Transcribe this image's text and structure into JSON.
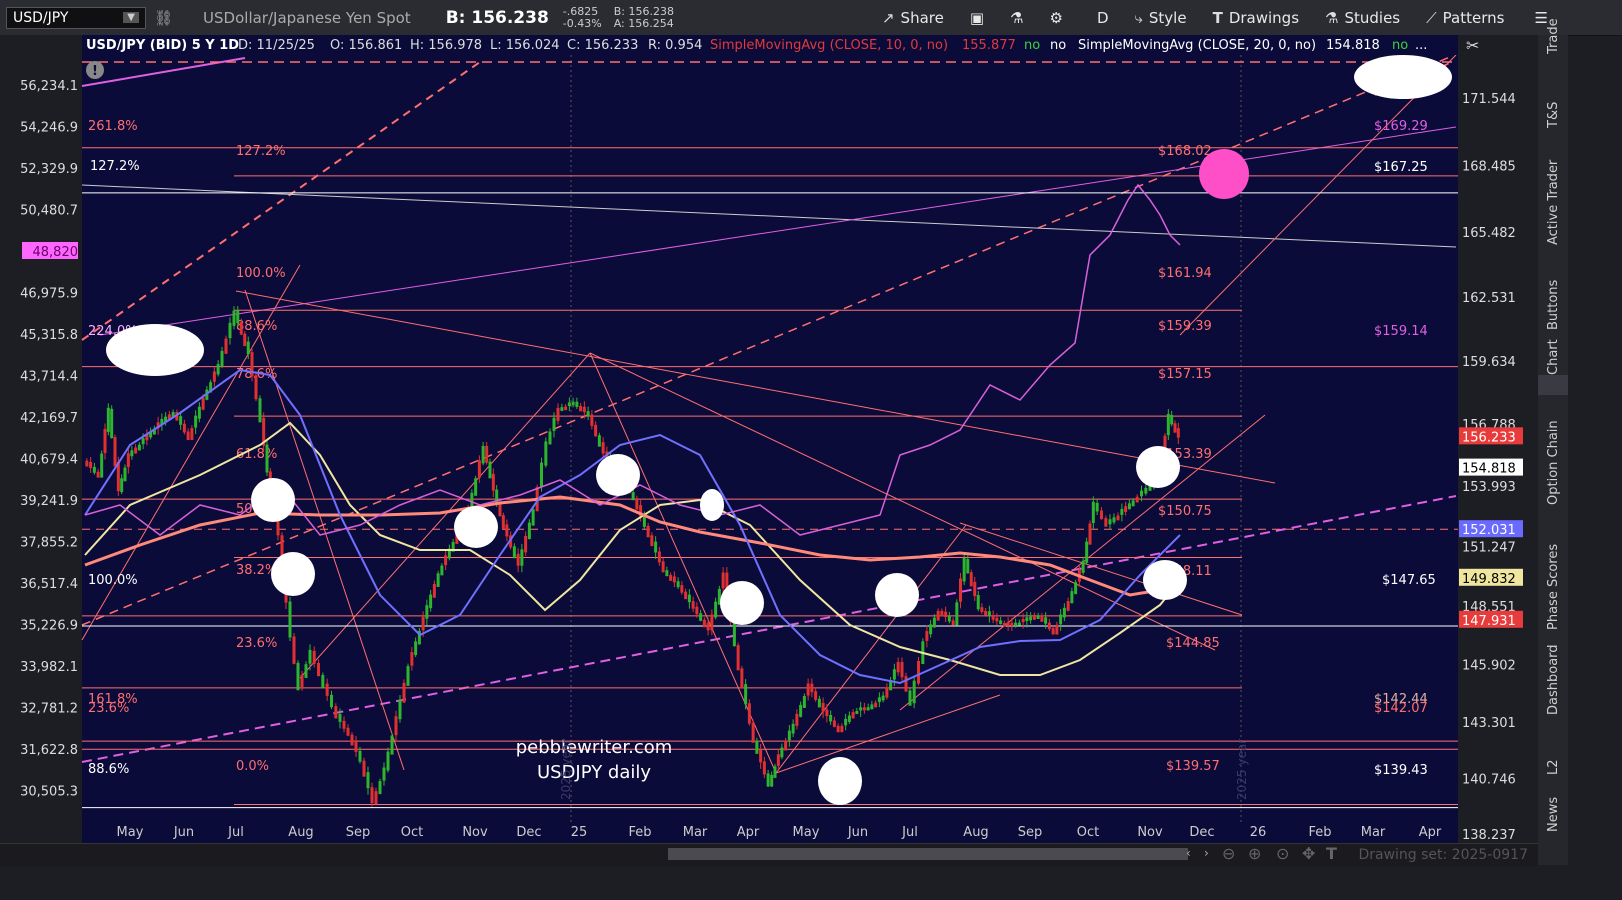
{
  "toolbar": {
    "symbol": "USD/JPY",
    "description": "USDollar/Japanese Yen Spot",
    "bid": "B: 156.238",
    "change": "-.6825",
    "change_pct": "-0.43%",
    "bid_small": "B: 156.238",
    "ask_small": "A: 156.254",
    "share_label": "Share",
    "period_label": "D",
    "style_label": "Style",
    "drawings_label": "Drawings",
    "studies_label": "Studies",
    "patterns_label": "Patterns"
  },
  "header": {
    "title": "USD/JPY (BID) 5 Y 1D",
    "date": "D: 11/25/25",
    "open": "O: 156.861",
    "high": "H: 156.978",
    "low": "L: 156.024",
    "close": "C: 156.233",
    "range": "R: 0.954",
    "sma10": "SimpleMovingAvg (CLOSE, 10, 0, no)",
    "sma10_val": "155.877",
    "no1": "no",
    "no2": "no",
    "sma20": "SimpleMovingAvg (CLOSE, 20, 0, no)",
    "sma20_val": "154.818",
    "no3": "no",
    "dots": "..."
  },
  "left_axis": [
    "56,234.1",
    "54,246.9",
    "52,329.9",
    "50,480.7",
    "48,820",
    "46,975.9",
    "45,315.8",
    "43,714.4",
    "42,169.7",
    "40,679.4",
    "39,241.9",
    "37,855.2",
    "36,517.4",
    "35,226.9",
    "33,982.1",
    "32,781.2",
    "31,622.8",
    "30,505.3"
  ],
  "right_axis": [
    "171.544",
    "168.485",
    "165.482",
    "162.531",
    "159.634",
    "156.788",
    "153.993",
    "151.247",
    "148.551",
    "145.902",
    "143.301",
    "140.746",
    "138.237"
  ],
  "price_tags": {
    "last": "156.233",
    "sma20": "154.818",
    "blue": "152.031",
    "yellow": "149.832",
    "red": "147.931"
  },
  "x_axis": [
    "May",
    "Jun",
    "Jul",
    "Aug",
    "Sep",
    "Oct",
    "Nov",
    "Dec",
    "25",
    "Feb",
    "Mar",
    "Apr",
    "May",
    "Jun",
    "Jul",
    "Aug",
    "Sep",
    "Oct",
    "Nov",
    "Dec",
    "26",
    "Feb",
    "Mar",
    "Apr"
  ],
  "fib_left": [
    "261.8%",
    "127.2%",
    "100.0%",
    "224.0%",
    "88.6%",
    "78.6%",
    "61.8%",
    "50.0%",
    "38.2%",
    "100.0%",
    "23.6%",
    "161.8%",
    "23.6%",
    "88.6%",
    "0.0%",
    "127.2%"
  ],
  "fib_right": [
    "$169.29",
    "$168.02",
    "$167.25",
    "$161.94",
    "$159.39",
    "$159.14",
    "$157.15",
    "$153.39",
    "$150.75",
    "$148.11",
    "$147.65",
    "$144.85",
    "$142.44",
    "$142.07",
    "$139.57",
    "$139.43"
  ],
  "watermark": {
    "line1": "pebblewriter.com",
    "line2": "USDJPY daily",
    "year1": "2025 year",
    "year2": "2025 year"
  },
  "side_tabs": [
    "Trade",
    "T&S",
    "Active Trader",
    "Buttons",
    "Chart",
    "Option Chain",
    "Phase Scores",
    "Dashboard",
    "L2",
    "News"
  ],
  "footer": {
    "drawing_set": "Drawing set: 2025-0917"
  },
  "colors": {
    "chart_bg": "#0b0b3a",
    "fib": "#ff6f6f",
    "magenta": "#e060e0",
    "green_candle": "#2db52d",
    "red_candle": "#e03030"
  }
}
